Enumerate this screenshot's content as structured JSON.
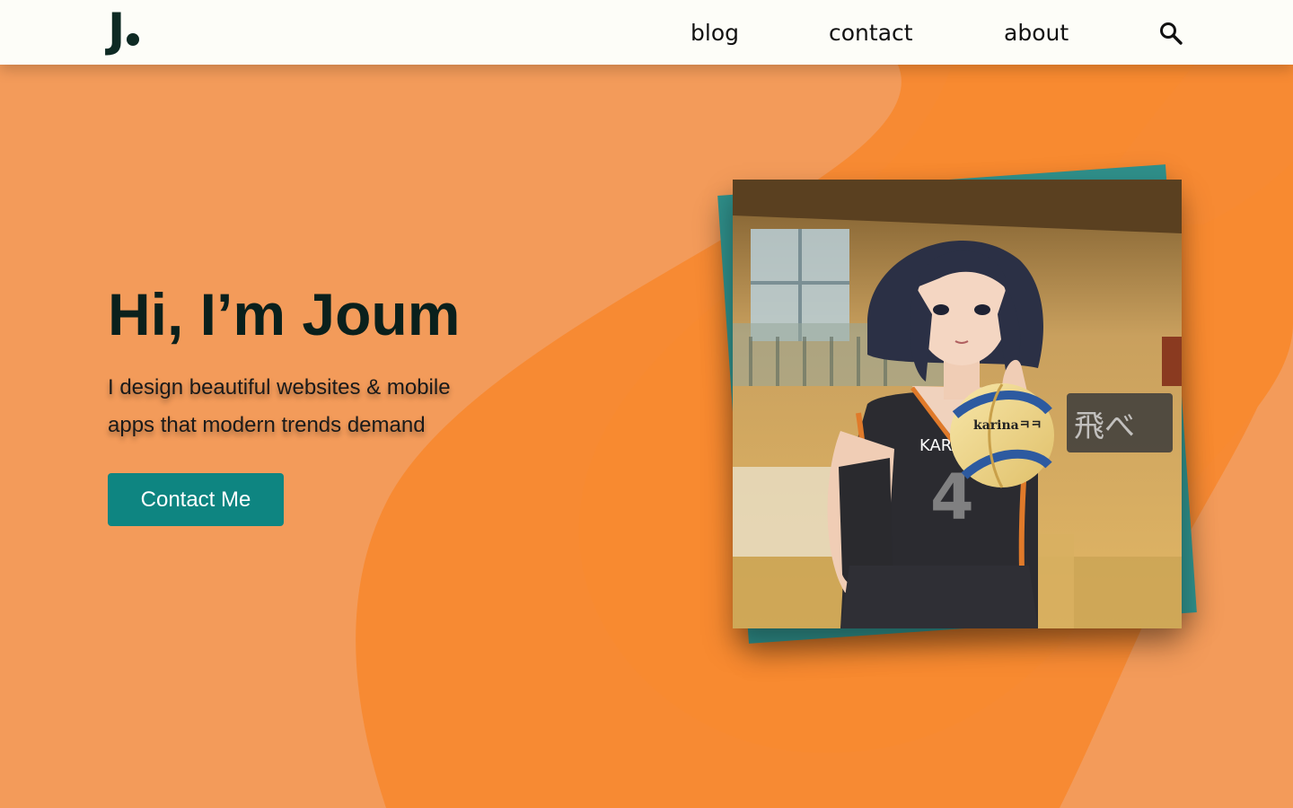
{
  "header": {
    "logo_letter": "J",
    "nav": {
      "blog": "blog",
      "contact": "contact",
      "about": "about"
    },
    "search_icon": "search-icon"
  },
  "hero": {
    "title": "Hi, I’m Joum",
    "subtitle": "I design beautiful websites & mobile apps that modern trends demand",
    "cta_label": "Contact Me"
  },
  "photo": {
    "ball_text": "karinaㅋㅋ",
    "jersey_text": "KARA",
    "jersey_number": "4",
    "banner_text": "飛べ"
  },
  "colors": {
    "background": "#f39b5a",
    "blob": "#f78a33",
    "header_bg": "#fdfdf8",
    "text_dark": "#0a201c",
    "accent_teal": "#0e8581"
  }
}
